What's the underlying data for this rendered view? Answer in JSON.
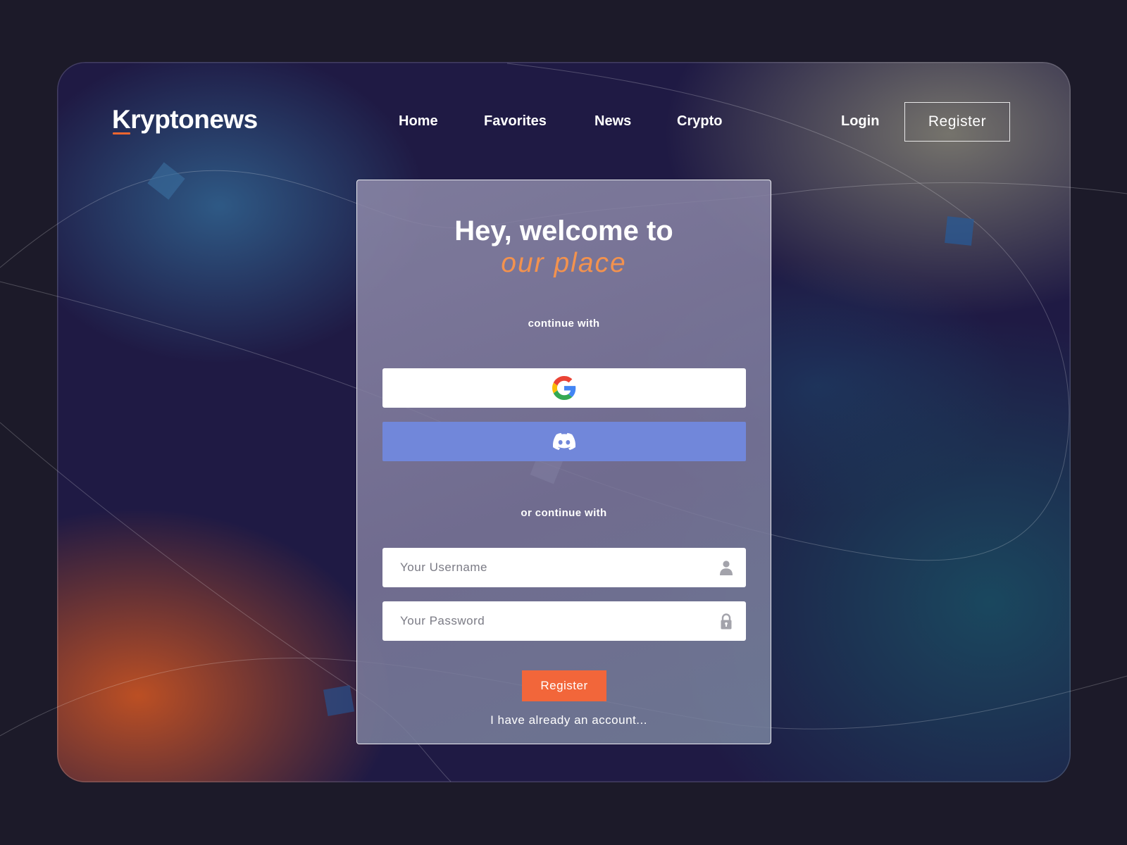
{
  "brand": {
    "name": "Kryptonews"
  },
  "nav": {
    "items": [
      {
        "label": "Home"
      },
      {
        "label": "Favorites"
      },
      {
        "label": "News"
      },
      {
        "label": "Crypto"
      }
    ],
    "login_label": "Login",
    "register_label": "Register"
  },
  "card": {
    "heading_line1": "Hey, welcome to",
    "heading_line2": "our place",
    "continue_with": "continue with",
    "or_continue_with": "or continue with",
    "social_buttons": [
      {
        "provider": "Google",
        "icon": "google-icon"
      },
      {
        "provider": "Discord",
        "icon": "discord-icon"
      }
    ],
    "username_placeholder": "Your Username",
    "password_placeholder": "Your Password",
    "submit_label": "Register",
    "account_link": "I have already an account..."
  },
  "colors": {
    "page_background": "#1c1a29",
    "accent_orange": "#f2663a",
    "heading_accent": "#f3924e",
    "discord_blue": "#7187da"
  },
  "icons": {
    "username_field": "user-icon",
    "password_field": "lock-icon"
  }
}
